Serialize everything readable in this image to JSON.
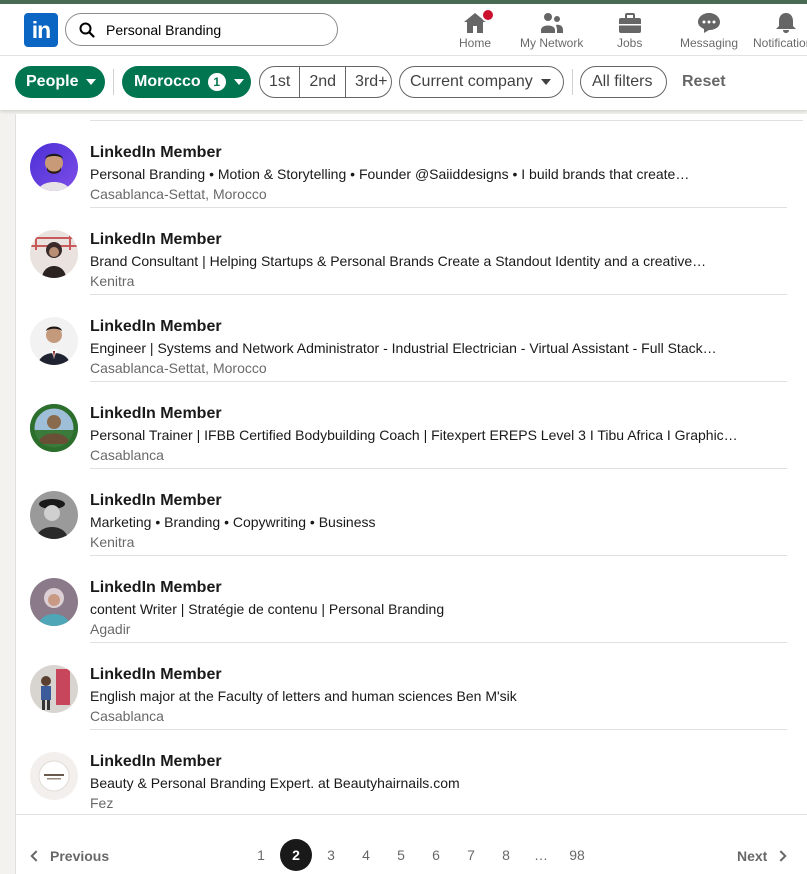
{
  "nav": {
    "logo_text": "in",
    "search_value": "Personal Branding",
    "items": [
      {
        "label": "Home",
        "icon": "home-icon"
      },
      {
        "label": "My Network",
        "icon": "people-icon"
      },
      {
        "label": "Jobs",
        "icon": "briefcase-icon"
      },
      {
        "label": "Messaging",
        "icon": "chat-icon"
      },
      {
        "label": "Notifications",
        "icon": "bell-icon"
      }
    ]
  },
  "filters": {
    "people_label": "People",
    "location_label": "Morocco",
    "location_count": "1",
    "degrees": [
      "1st",
      "2nd",
      "3rd+"
    ],
    "company_label": "Current company",
    "all_filters_label": "All filters",
    "reset_label": "Reset"
  },
  "colors": {
    "brand": "#0a66c2",
    "filter_active": "#01754f",
    "notification_badge": "#cb112d"
  },
  "results": [
    {
      "name": "LinkedIn Member",
      "headline": "Personal Branding • Motion & Storytelling • Founder @Saiiddesigns • I build brands that create…",
      "location": "Casablanca-Settat, Morocco"
    },
    {
      "name": "LinkedIn Member",
      "headline": "Brand Consultant | Helping Startups & Personal Brands Create a Standout Identity and a creative…",
      "location": "Kenitra"
    },
    {
      "name": "LinkedIn Member",
      "headline": "Engineer | Systems and Network Administrator - Industrial Electrician - Virtual Assistant - Full Stack…",
      "location": "Casablanca-Settat, Morocco"
    },
    {
      "name": "LinkedIn Member",
      "headline": "Personal Trainer | IFBB Certified Bodybuilding Coach | Fitexpert EREPS Level 3 I Tibu Africa I Graphic…",
      "location": "Casablanca"
    },
    {
      "name": "LinkedIn Member",
      "headline": "Marketing • Branding • Copywriting • Business",
      "location": "Kenitra"
    },
    {
      "name": "LinkedIn Member",
      "headline": "content Writer | Stratégie de contenu | Personal Branding",
      "location": "Agadir"
    },
    {
      "name": "LinkedIn Member",
      "headline": "English major at the Faculty of letters and human sciences Ben M'sik",
      "location": "Casablanca"
    },
    {
      "name": "LinkedIn Member",
      "headline": "Beauty & Personal Branding Expert. at Beautyhairnails.com",
      "location": "Fez"
    }
  ],
  "pagination": {
    "prev_label": "Previous",
    "next_label": "Next",
    "pages": [
      "1",
      "2",
      "3",
      "4",
      "5",
      "6",
      "7",
      "8",
      "…",
      "98"
    ],
    "current": "2"
  }
}
